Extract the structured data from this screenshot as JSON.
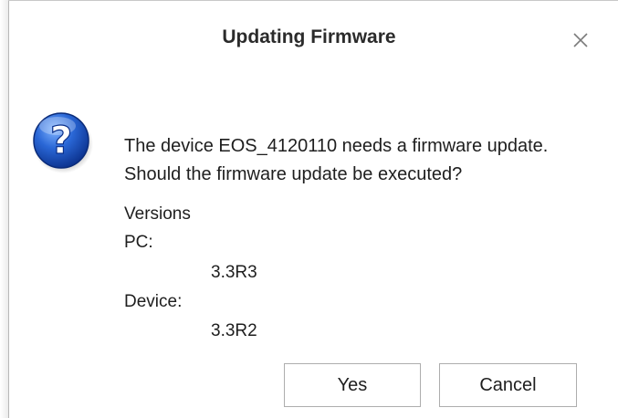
{
  "dialog": {
    "title": "Updating Firmware",
    "icon": "question-icon",
    "message_line1": "The device EOS_4120110 needs a firmware update.",
    "message_line2": "Should the firmware update be executed?",
    "versions": {
      "header": "Versions",
      "pc_label": "PC:",
      "pc_value": "3.3R3",
      "device_label": "Device:",
      "device_value": "3.3R2"
    },
    "buttons": {
      "yes_label": "Yes",
      "cancel_label": "Cancel"
    }
  }
}
